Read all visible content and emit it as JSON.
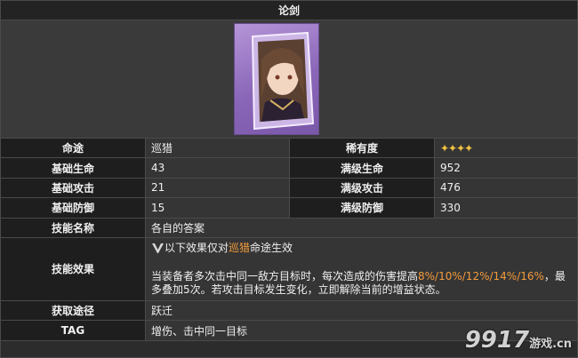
{
  "title": "论剑",
  "rows": [
    {
      "label1": "命途",
      "value1": "巡猎",
      "label2": "稀有度",
      "value2": "✦✦✦✦"
    },
    {
      "label1": "基础生命",
      "value1": "43",
      "label2": "满级生命",
      "value2": "952"
    },
    {
      "label1": "基础攻击",
      "value1": "21",
      "label2": "满级攻击",
      "value2": "476"
    },
    {
      "label1": "基础防御",
      "value1": "15",
      "label2": "满级防御",
      "value2": "330"
    }
  ],
  "skill_name": {
    "label": "技能名称",
    "value": "各自的答案"
  },
  "skill_effect": {
    "label": "技能效果",
    "line1_prefix": "以下效果仅对",
    "line1_highlight": "巡猎",
    "line1_suffix": "命途生效",
    "line2_prefix": "当装备者多次击中同一敌方目标时，每次造成的伤害提高",
    "line2_highlight": "8%/10%/12%/14%/16%",
    "line2_suffix": "，最多叠加5次。若攻击目标发生变化，立即解除当前的增益状态。"
  },
  "obtain": {
    "label": "获取途径",
    "value": "跃迁"
  },
  "tag": {
    "label": "TAG",
    "value": "增伤、击中同一目标"
  },
  "watermark": {
    "main": "9917",
    "sub": "游戏",
    "suffix": ".cn"
  },
  "colors": {
    "highlight": "#f39b3c",
    "stars": "#f2c442"
  }
}
